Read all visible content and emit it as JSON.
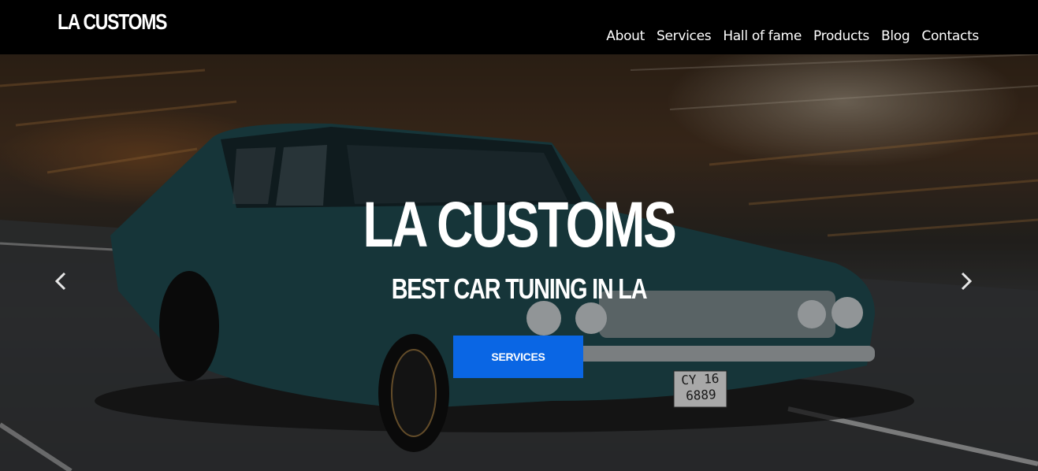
{
  "header": {
    "brand": "LA CUSTOMS",
    "nav": [
      "About",
      "Services",
      "Hall of fame",
      "Products",
      "Blog",
      "Contacts"
    ]
  },
  "hero": {
    "title": "LA CUSTOMS",
    "subtitle": "BEST CAR TUNING IN LA",
    "button_label": "SERVICES",
    "plate_line1": "CY 16",
    "plate_line2": "6889",
    "prev_icon": "chevron-left-icon",
    "next_icon": "chevron-right-icon"
  },
  "colors": {
    "topbar": "#000000",
    "button": "#0a66e4",
    "text": "#ffffff",
    "car": "#1f4a4f"
  }
}
